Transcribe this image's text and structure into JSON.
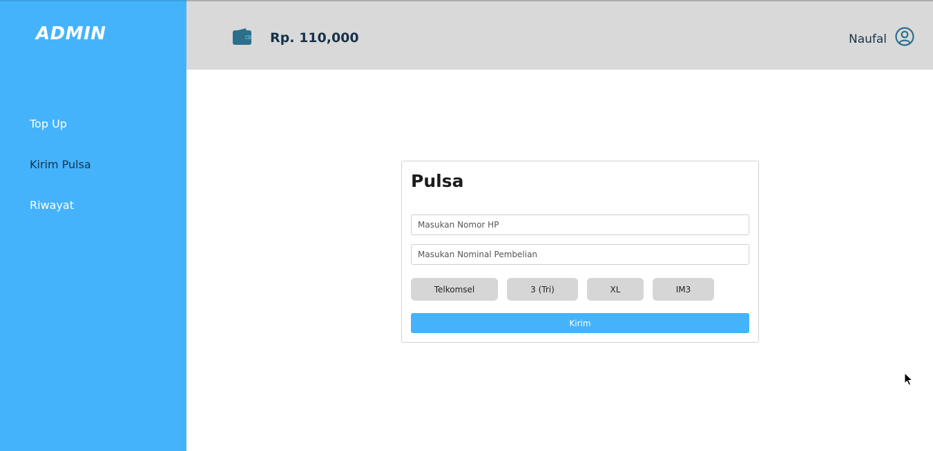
{
  "sidebar": {
    "brand": "ADMIN",
    "items": [
      {
        "label": "Top Up"
      },
      {
        "label": "Kirim Pulsa"
      },
      {
        "label": "Riwayat"
      }
    ]
  },
  "header": {
    "balance": "Rp. 110,000",
    "wallet_icon": "wallet-icon",
    "username": "Naufal",
    "user_icon": "user-circle-icon"
  },
  "form": {
    "title": "Pulsa",
    "phone_placeholder": "Masukan Nomor HP",
    "nominal_placeholder": "Masukan Nominal Pembelian",
    "operators": [
      "Telkomsel",
      "3 (Tri)",
      "XL",
      "IM3"
    ],
    "submit_label": "Kirim"
  },
  "colors": {
    "sidebar": "#45b3fb",
    "header": "#d9d9d9",
    "accent": "#45b3fb",
    "text_dark": "#17324a"
  }
}
